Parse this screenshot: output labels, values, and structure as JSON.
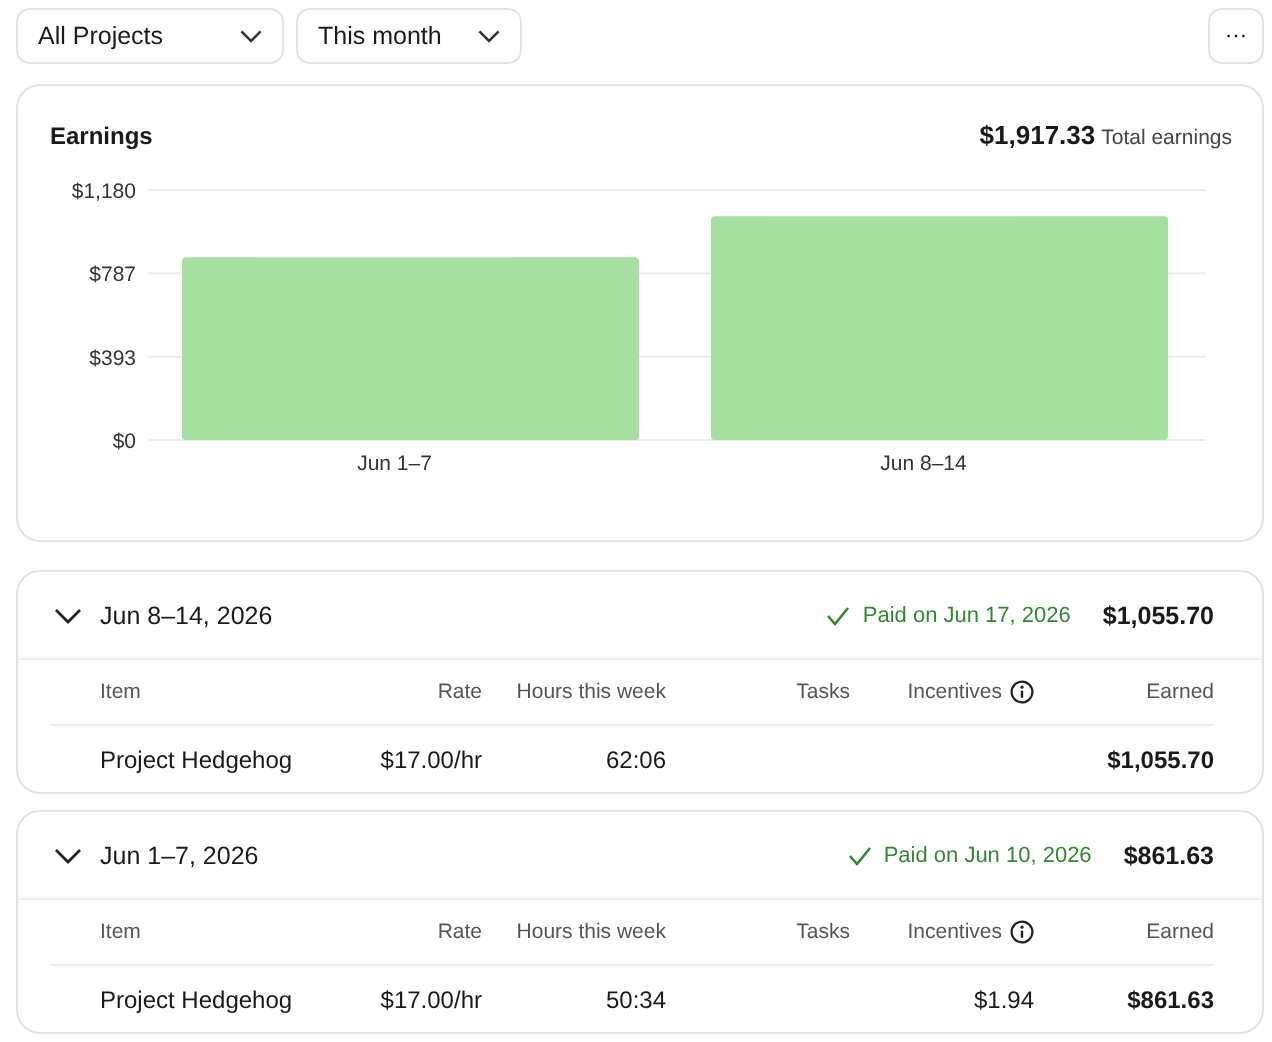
{
  "filters": [
    {
      "label": "All Projects"
    },
    {
      "label": "This month"
    }
  ],
  "more_button": {
    "label": "···"
  },
  "earnings": {
    "title": "Earnings",
    "total": "$1,917.33",
    "total_label": "Total earnings",
    "chart_data": {
      "type": "bar",
      "categories": [
        "Jun 1–7",
        "Jun 8–14"
      ],
      "series": [
        {
          "color": "#a5e0a0",
          "values": [
            862,
            1056
          ]
        }
      ],
      "ylim": [
        0,
        1180
      ],
      "yticks": [
        {
          "value": 0,
          "label": "$0"
        },
        {
          "value": 393,
          "label": "$393"
        },
        {
          "value": 787,
          "label": "$787"
        },
        {
          "value": 1180,
          "label": "$1,180"
        }
      ]
    }
  },
  "weeks": [
    {
      "title": "Jun 8–14, 2026",
      "expanded": true,
      "status": "Paid on Jun 17, 2026",
      "amount": "$1,055.70",
      "columns": [
        "Item",
        "Rate",
        "Hours this week",
        "Tasks",
        "Incentives",
        "Earned"
      ],
      "rows": [
        {
          "item": "Project Hedgehog",
          "rate": "$17.00/hr",
          "hours": "62:06",
          "earned": "$1,055.70"
        }
      ]
    },
    {
      "title": "Jun 1–7, 2026",
      "expanded": true,
      "status": "Paid on Jun 10, 2026",
      "amount": "$861.63",
      "columns": [
        "Item",
        "Rate",
        "Hours this week",
        "Tasks",
        "Incentives",
        "Earned"
      ],
      "rows": [
        {
          "item": "Project Hedgehog",
          "rate": "$17.00/hr",
          "hours": "50:34",
          "incentives": "$1.94",
          "earned": "$861.63"
        }
      ]
    }
  ]
}
